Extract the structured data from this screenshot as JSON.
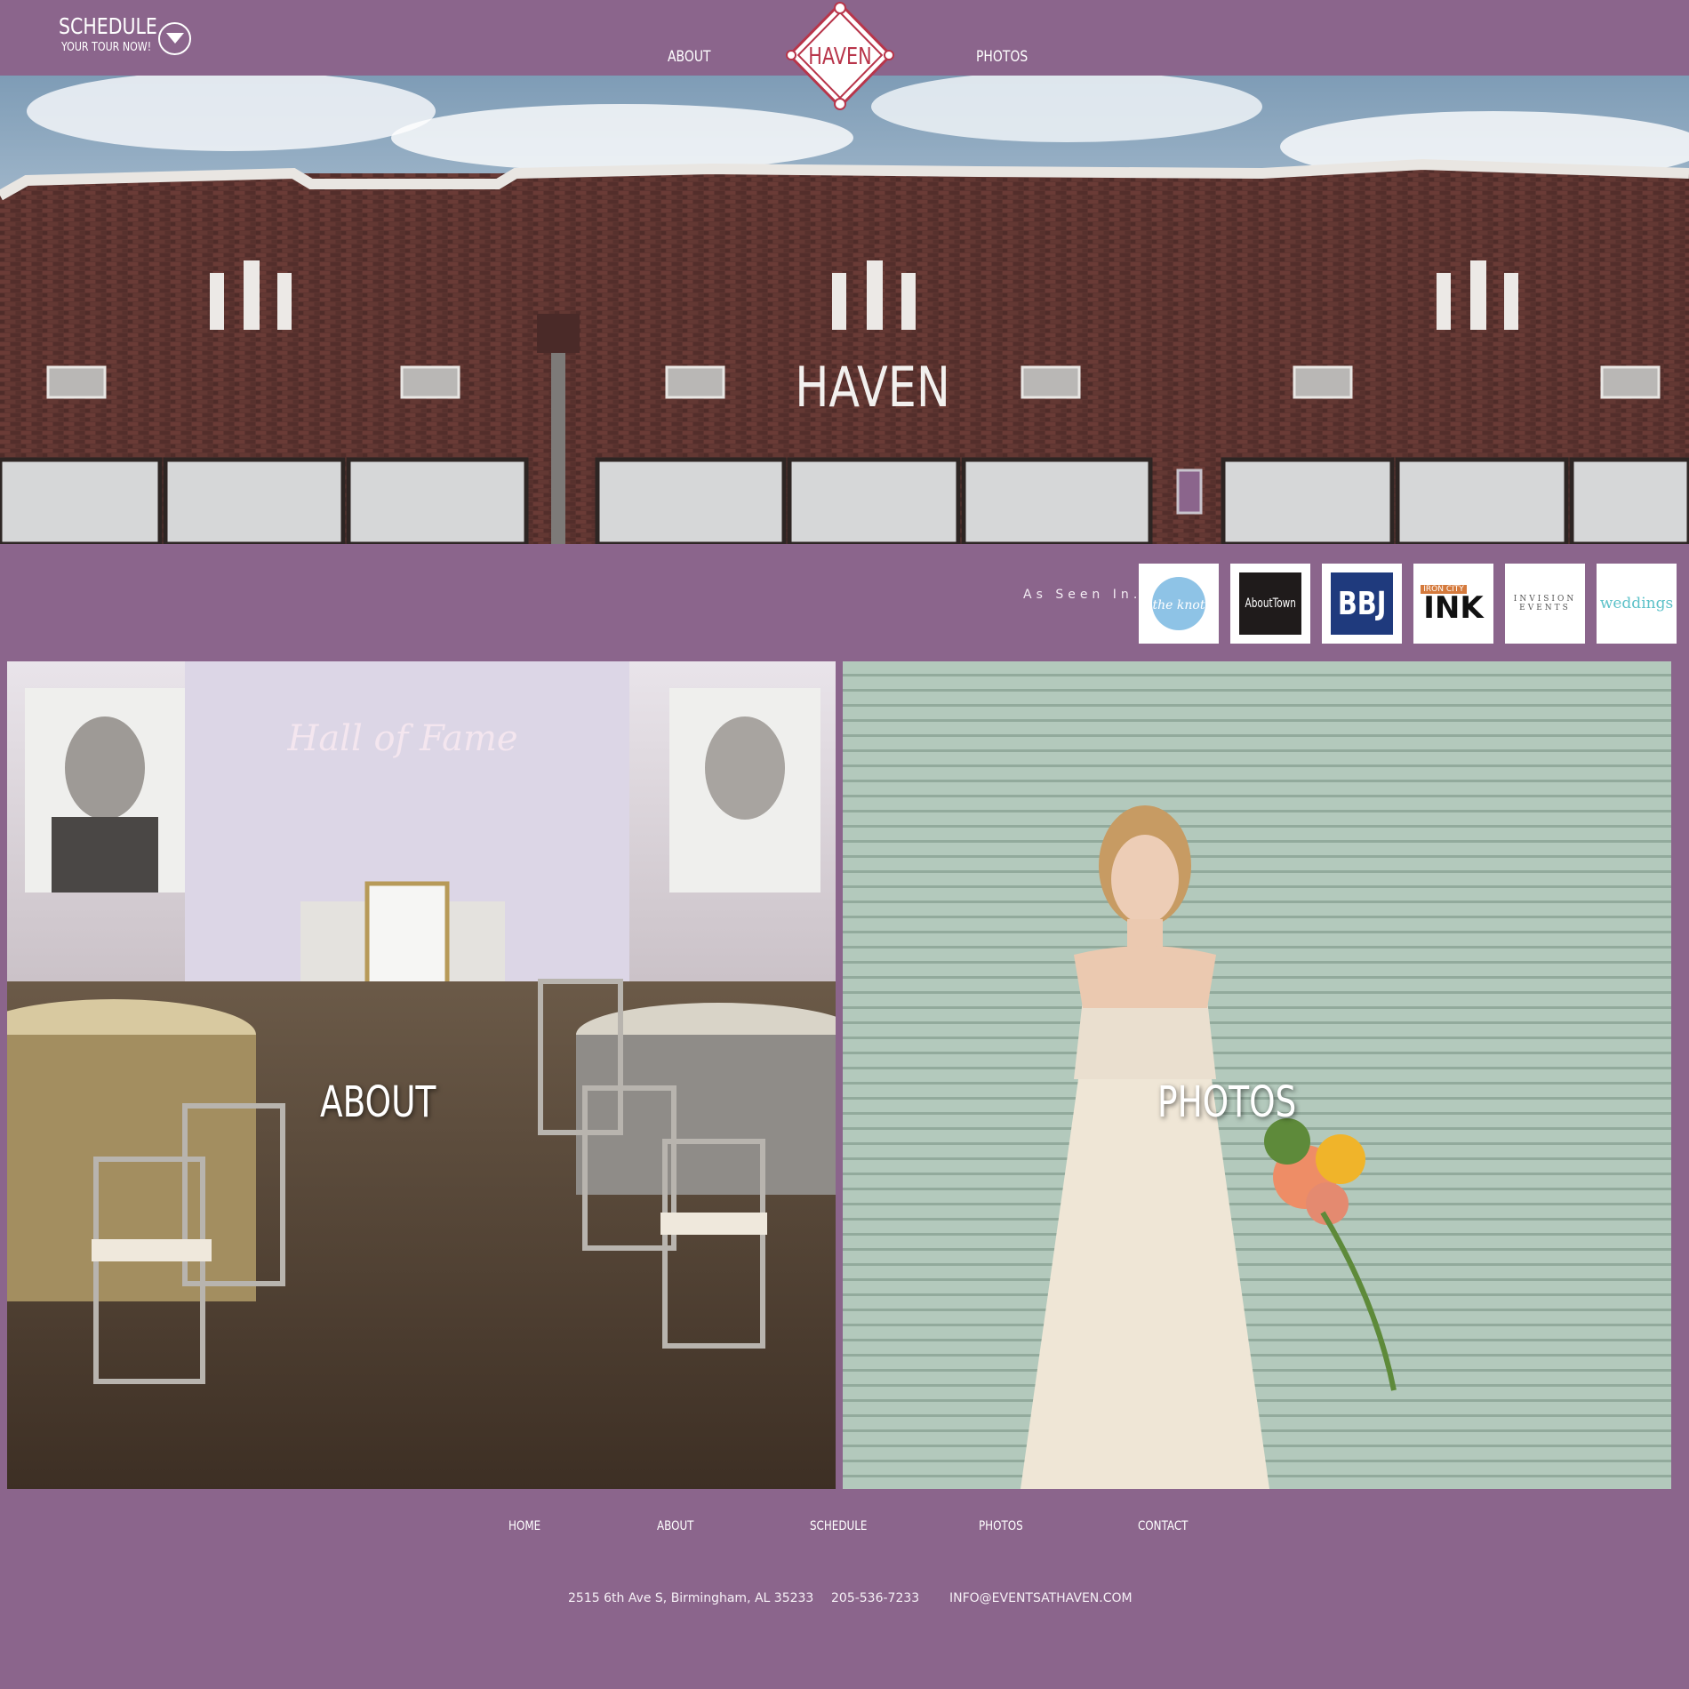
{
  "header": {
    "schedule_title": "SCHEDULE",
    "schedule_subtitle": "YOUR TOUR NOW!",
    "nav_about": "ABOUT",
    "nav_photos": "PHOTOS",
    "logo_text": "HAVEN"
  },
  "hero": {
    "building_sign": "HAVEN"
  },
  "press": {
    "label": "As Seen In…",
    "logos": [
      {
        "name": "the knot"
      },
      {
        "name": "AboutTown"
      },
      {
        "name": "BBJ"
      },
      {
        "name": "IRON CITY INK",
        "top": "IRON CITY",
        "main": "INK"
      },
      {
        "name": "INVISION EVENTS",
        "line1": "INVISION",
        "line2": "EVENTS"
      },
      {
        "name": "weddings"
      }
    ]
  },
  "tiles": {
    "about_label": "ABOUT",
    "about_sign": "Hall of Fame",
    "photos_label": "PHOTOS"
  },
  "footer": {
    "nav": [
      "HOME",
      "ABOUT",
      "SCHEDULE",
      "PHOTOS",
      "CONTACT"
    ],
    "address": "2515 6th Ave S, Birmingham, AL 35233",
    "phone": "205-536-7233",
    "email": "INFO@EVENTSATHAVEN.COM"
  },
  "colors": {
    "brand_purple": "#8b658c",
    "logo_red": "#b8354a"
  }
}
